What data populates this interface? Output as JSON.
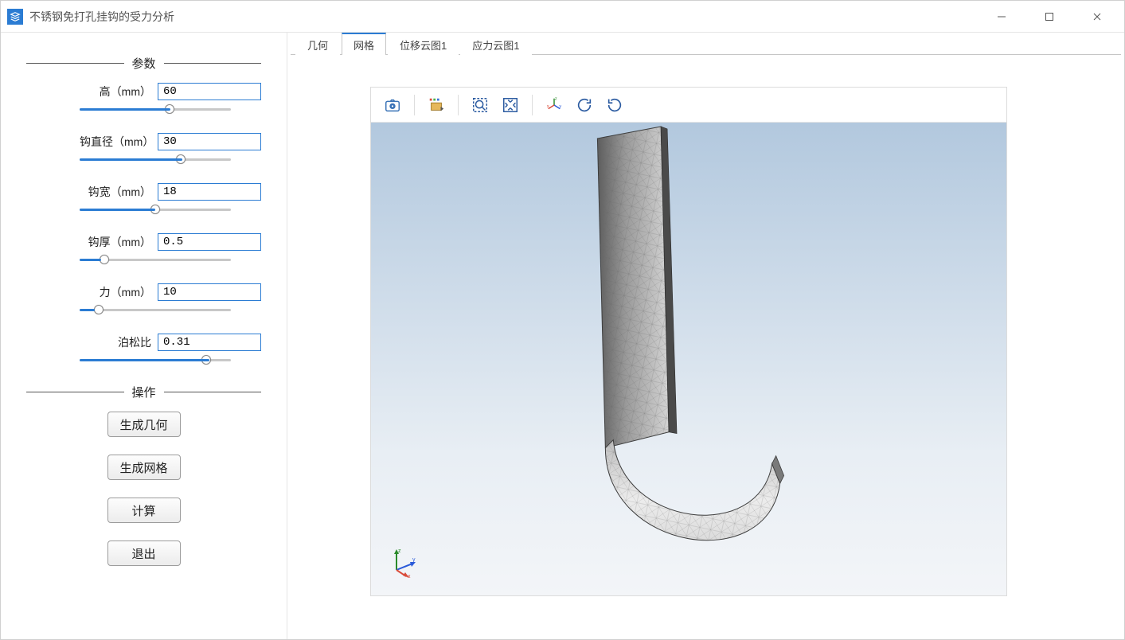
{
  "window": {
    "title": "不锈钢免打孔挂钩的受力分析"
  },
  "sidebar": {
    "section_params": "参数",
    "section_actions": "操作",
    "params": [
      {
        "label": "高（mm）",
        "value": "60",
        "slider": 60,
        "min": 0,
        "max": 100
      },
      {
        "label": "钩直径（mm）",
        "value": "30",
        "slider": 68,
        "min": 0,
        "max": 100
      },
      {
        "label": "钩宽（mm）",
        "value": "18",
        "slider": 50,
        "min": 0,
        "max": 100
      },
      {
        "label": "钩厚（mm）",
        "value": "0.5",
        "slider": 14,
        "min": 0,
        "max": 100
      },
      {
        "label": "力（mm）",
        "value": "10",
        "slider": 10,
        "min": 0,
        "max": 100
      },
      {
        "label": "泊松比",
        "value": "0.31",
        "slider": 86,
        "min": 0,
        "max": 100
      }
    ],
    "actions": {
      "gen_geom": "生成几何",
      "gen_mesh": "生成网格",
      "compute": "计算",
      "exit": "退出"
    }
  },
  "tabs": {
    "items": [
      "几何",
      "网格",
      "位移云图1",
      "应力云图1"
    ],
    "active_index": 1
  },
  "toolbar": {
    "icons": [
      "camera-icon",
      "selection-mode-icon",
      "zoom-box-icon",
      "fit-view-icon",
      "axes-icon",
      "rotate-cw-icon",
      "rotate-ccw-icon"
    ]
  },
  "axis": {
    "x": "x",
    "y": "y",
    "z": "z"
  }
}
